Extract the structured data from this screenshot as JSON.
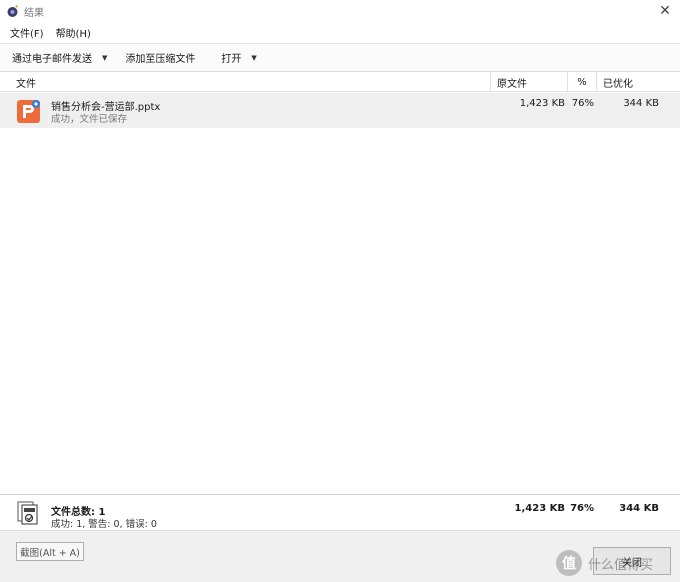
{
  "window": {
    "title": "结果"
  },
  "menu": {
    "file": "文件(F)",
    "help": "帮助(H)"
  },
  "toolbar": {
    "email": "通过电子邮件发送",
    "add_archive": "添加至压缩文件",
    "open": "打开"
  },
  "columns": {
    "file": "文件",
    "original": "原文件",
    "percent": "%",
    "optimized": "已优化"
  },
  "files": [
    {
      "name": "销售分析会-营运部.pptx",
      "status": "成功，文件已保存",
      "original": "1,423 KB",
      "percent": "76%",
      "optimized": "344 KB",
      "icon": "powerpoint-icon"
    }
  ],
  "summary": {
    "title": "文件总数: 1",
    "detail": "成功: 1, 警告: 0, 错误: 0",
    "original": "1,423 KB",
    "percent": "76%",
    "optimized": "344 KB"
  },
  "buttons": {
    "screenshot": "截图(Alt + A)",
    "close": "关闭"
  },
  "watermark": {
    "glyph": "值",
    "text": "什么值得买"
  },
  "colors": {
    "accent_orange": "#ef6b3a",
    "row_highlight": "#efefef"
  }
}
